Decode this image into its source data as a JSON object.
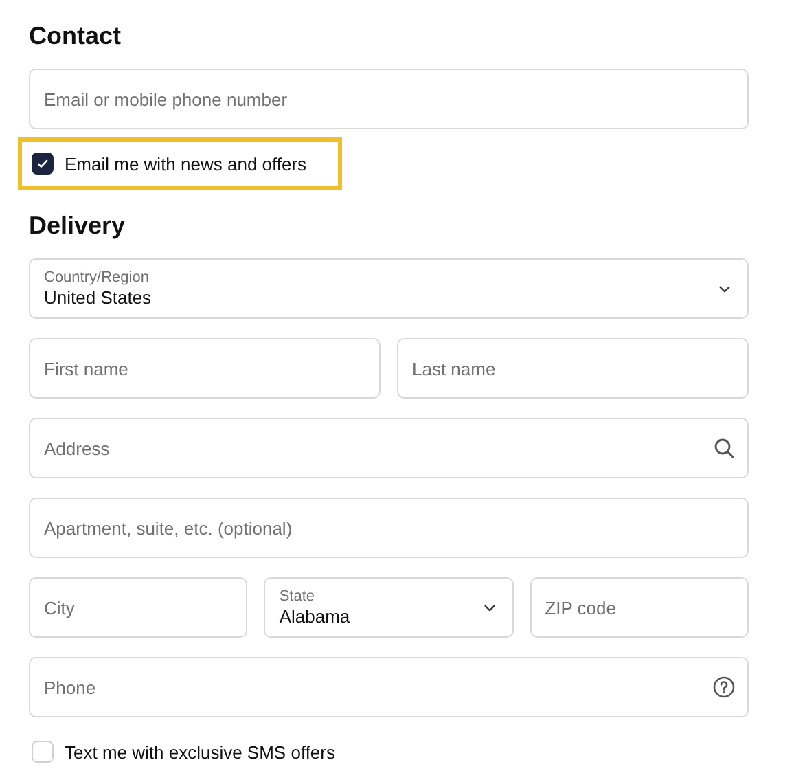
{
  "contact": {
    "heading": "Contact",
    "email": {
      "placeholder": "Email or mobile phone number"
    },
    "newsletter": {
      "label": "Email me with news and offers",
      "checked": true,
      "highlighted": true
    }
  },
  "delivery": {
    "heading": "Delivery",
    "rows": [
      [
        {
          "kind": "select",
          "label": "Country/Region",
          "value": "United States"
        }
      ],
      [
        {
          "kind": "text",
          "placeholder": "First name"
        },
        {
          "kind": "text",
          "placeholder": "Last name"
        }
      ],
      [
        {
          "kind": "search",
          "placeholder": "Address"
        }
      ],
      [
        {
          "kind": "text",
          "placeholder": "Apartment, suite, etc. (optional)"
        }
      ],
      [
        {
          "kind": "text",
          "placeholder": "City"
        },
        {
          "kind": "select",
          "label": "State",
          "value": "Alabama"
        },
        {
          "kind": "text",
          "placeholder": "ZIP code"
        }
      ],
      [
        {
          "kind": "help",
          "placeholder": "Phone"
        }
      ]
    ],
    "sms": {
      "label": "Text me with exclusive SMS offers",
      "checked": false
    }
  }
}
